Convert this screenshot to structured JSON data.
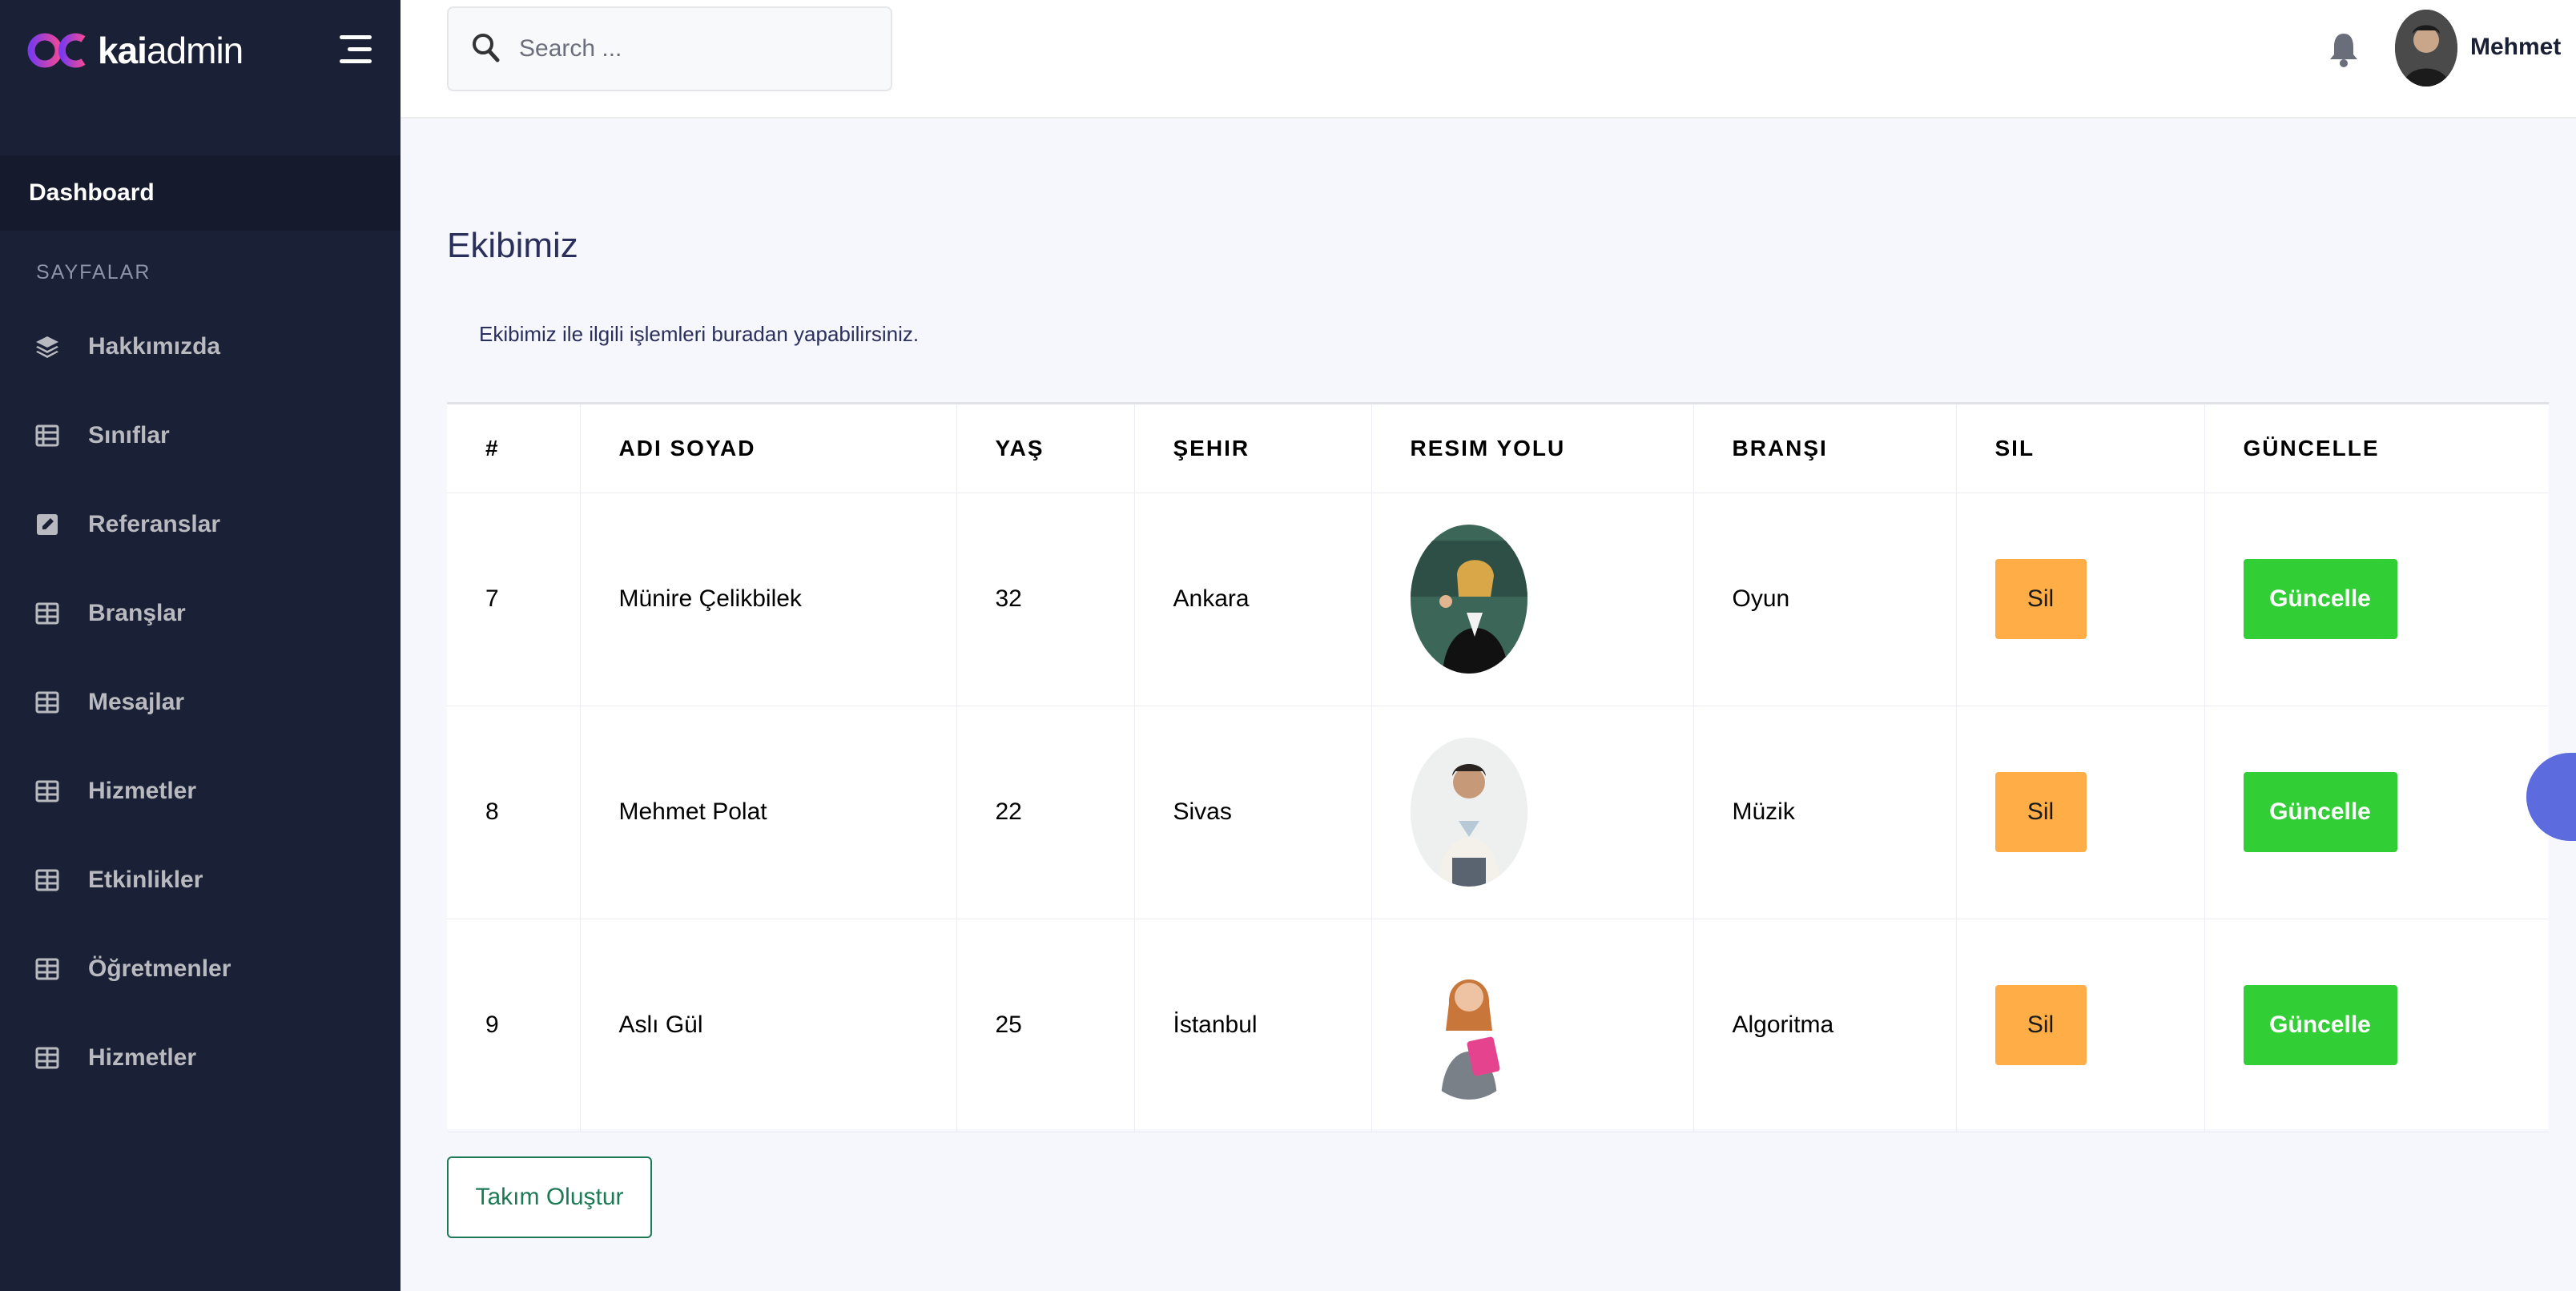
{
  "brand": {
    "bold": "kai",
    "light": "admin",
    "mark_color_a": "#7c3aed",
    "mark_color_b": "#ec4899"
  },
  "header": {
    "search_placeholder": "Search ...",
    "username": "Mehmet"
  },
  "sidebar": {
    "dashboard": "Dashboard",
    "section": "SAYFALAR",
    "items": [
      {
        "label": "Hakkımızda",
        "icon": "layers-icon"
      },
      {
        "label": "Sınıflar",
        "icon": "list-icon"
      },
      {
        "label": "Referanslar",
        "icon": "edit-square-icon"
      },
      {
        "label": "Branşlar",
        "icon": "table-icon"
      },
      {
        "label": "Mesajlar",
        "icon": "table-icon"
      },
      {
        "label": "Hizmetler",
        "icon": "table-icon"
      },
      {
        "label": "Etkinlikler",
        "icon": "table-icon"
      },
      {
        "label": "Öğretmenler",
        "icon": "table-icon"
      },
      {
        "label": "Hizmetler",
        "icon": "table-icon"
      }
    ]
  },
  "main": {
    "title": "Ekibimiz",
    "description": "Ekibimiz ile ilgili işlemleri buradan yapabilirsiniz.",
    "columns": [
      "#",
      "ADI SOYAD",
      "YAŞ",
      "ŞEHIR",
      "RESIM YOLU",
      "BRANŞI",
      "SIL",
      "GÜNCELLE"
    ],
    "rows": [
      {
        "id": "7",
        "name": "Münire Çelikbilek",
        "age": "32",
        "city": "Ankara",
        "branch": "Oyun",
        "delete": "Sil",
        "update": "Güncelle"
      },
      {
        "id": "8",
        "name": "Mehmet Polat",
        "age": "22",
        "city": "Sivas",
        "branch": "Müzik",
        "delete": "Sil",
        "update": "Güncelle"
      },
      {
        "id": "9",
        "name": "Aslı Gül",
        "age": "25",
        "city": "İstanbul",
        "branch": "Algoritma",
        "delete": "Sil",
        "update": "Güncelle"
      }
    ],
    "create_button": "Takım Oluştur"
  },
  "colors": {
    "sidebar": "#1a2035",
    "delete": "#ffad46",
    "update": "#31ce36",
    "create": "#1d7a55",
    "fab": "#5c6bde"
  }
}
